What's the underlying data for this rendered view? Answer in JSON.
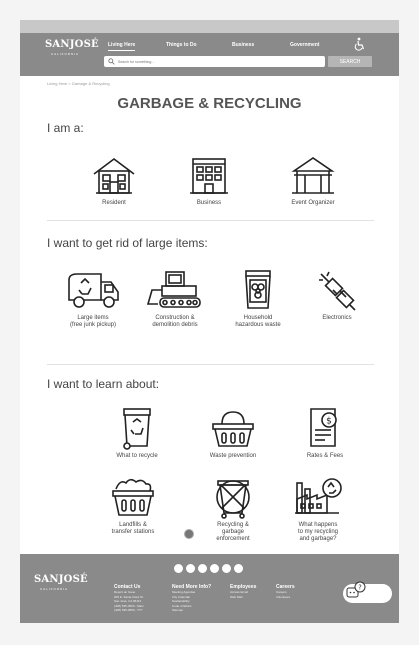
{
  "brand": {
    "logo_text": "SANJOSÉ",
    "logo_sub": "CALIFORNIA"
  },
  "nav": {
    "items": [
      {
        "label": "Living Here"
      },
      {
        "label": "Things to Do"
      },
      {
        "label": "Business"
      },
      {
        "label": "Government"
      }
    ]
  },
  "search": {
    "placeholder": "Search for something...",
    "button_label": "SEARCH"
  },
  "breadcrumb": "Living Here > Garbage & Recycling",
  "page_title": "GARBAGE & RECYCLING",
  "sections": {
    "i_am": {
      "heading": "I am a:",
      "tiles": [
        {
          "label": "Resident",
          "icon": "house-icon"
        },
        {
          "label": "Business",
          "icon": "office-building-icon"
        },
        {
          "label": "Event Organizer",
          "icon": "tent-icon"
        }
      ]
    },
    "large_items": {
      "heading": "I want to get rid of large items:",
      "tiles": [
        {
          "label": "Large items",
          "label2": "(free junk pickup)",
          "icon": "recycling-truck-icon"
        },
        {
          "label": "Construction &",
          "label2": "demolition debris",
          "icon": "bulldozer-icon"
        },
        {
          "label": "Household",
          "label2": "hazardous waste",
          "icon": "biohazard-bin-icon"
        },
        {
          "label": "Electronics",
          "icon": "electrical-plug-icon"
        }
      ]
    },
    "learn": {
      "heading": "I want to learn about:",
      "tiles": [
        {
          "label": "What to recycle",
          "icon": "recycling-bin-icon"
        },
        {
          "label": "Waste prevention",
          "icon": "basket-icon"
        },
        {
          "label": "Rates & Fees",
          "icon": "bill-icon"
        },
        {
          "label": "Landfills &",
          "label2": "transfer stations",
          "icon": "landfill-icon"
        },
        {
          "label": "Recycling &",
          "label2": "garbage",
          "label3": "enforcement",
          "icon": "no-dumping-icon"
        },
        {
          "label": "What happens",
          "label2": "to my recycling",
          "label3": "and garbage?",
          "icon": "factory-icon"
        }
      ]
    }
  },
  "footer": {
    "columns": [
      {
        "title": "Contact Us",
        "items": [
          "Report an Issue",
          "200 E. Santa Clara St.",
          "San José, CA 95113",
          "(408) 535-3500 - Main",
          "(408) 535-3550 - TTY"
        ]
      },
      {
        "title": "Need More Info?",
        "items": [
          "Meeting Agendas",
          "City Calendar",
          "Sustainability",
          "Code of Ethics",
          "Sitemap"
        ]
      },
      {
        "title": "Employees",
        "items": [
          "Access Email",
          "Web Mail"
        ]
      },
      {
        "title": "Careers",
        "items": [
          "Careers",
          "Volunteers"
        ]
      }
    ],
    "social_icons": [
      "youtube-icon",
      "facebook-icon",
      "instagram-icon",
      "twitter-icon",
      "linkedin-icon",
      "nextdoor-icon"
    ]
  }
}
